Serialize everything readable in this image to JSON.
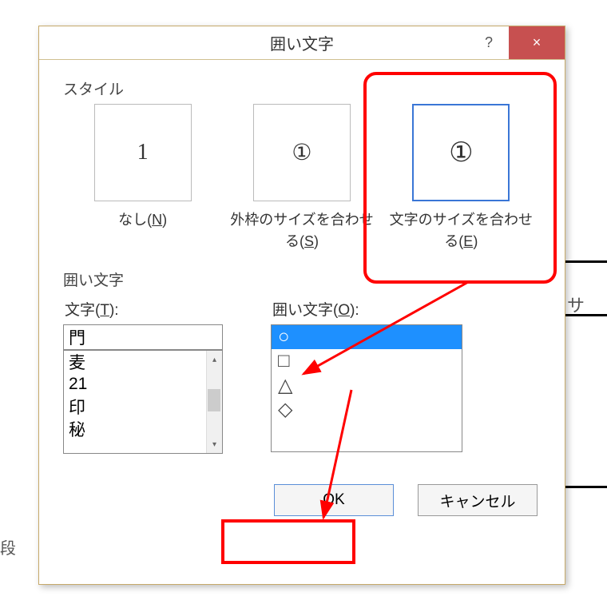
{
  "dialog": {
    "title": "囲い文字",
    "help": "?",
    "close": "×"
  },
  "style": {
    "section": "スタイル",
    "items": [
      {
        "preview": "1",
        "caption_prefix": "なし(",
        "key": "N",
        "caption_suffix": ")"
      },
      {
        "preview": "①",
        "caption_prefix": "外枠のサイズを合わせる(",
        "key": "S",
        "caption_suffix": ")"
      },
      {
        "preview": "①",
        "caption_prefix": "文字のサイズを合わせる(",
        "key": "E",
        "caption_suffix": ")"
      }
    ]
  },
  "enclose_section": "囲い文字",
  "text_field": {
    "label_pre": "文字(",
    "label_key": "T",
    "label_post": "):",
    "value": "門",
    "options": [
      "麦",
      "21",
      "印",
      "秘"
    ]
  },
  "enclosure_field": {
    "label_pre": "囲い文字(",
    "label_key": "O",
    "label_post": "):",
    "options": [
      "○",
      "□",
      "△",
      "◇"
    ],
    "selected_index": 0
  },
  "buttons": {
    "ok": "OK",
    "cancel": "キャンセル"
  },
  "bg": {
    "left": "段",
    "right": "サ"
  }
}
